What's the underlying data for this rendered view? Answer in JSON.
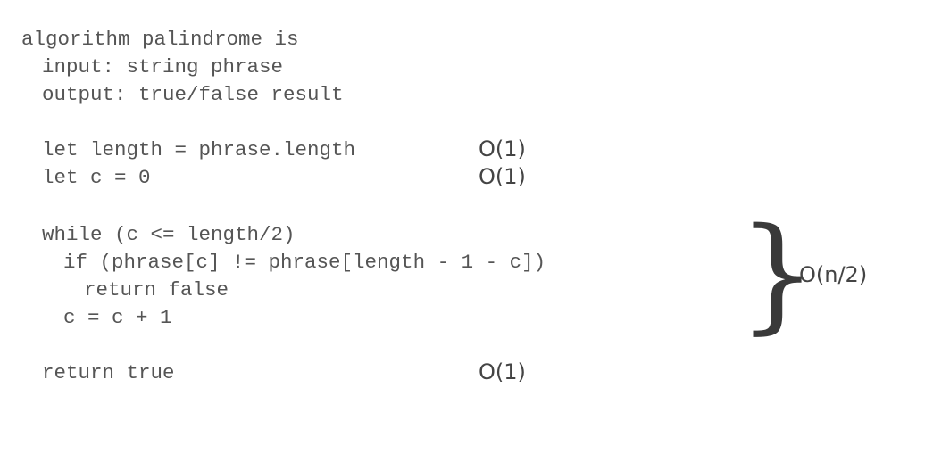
{
  "code": {
    "lines": [
      "algorithm palindrome is",
      "input: string phrase",
      "output: true/false result",
      "let length = phrase.length",
      "let c = 0",
      "while (c <= length/2)",
      "if (phrase[c] != phrase[length - 1 - c])",
      "return false",
      "c = c + 1",
      "return true"
    ]
  },
  "annotations": {
    "length_cost": "O(1)",
    "c_init_cost": "O(1)",
    "loop_cost": "O(n/2)",
    "return_cost": "O(1)",
    "brace_glyph": "}"
  }
}
